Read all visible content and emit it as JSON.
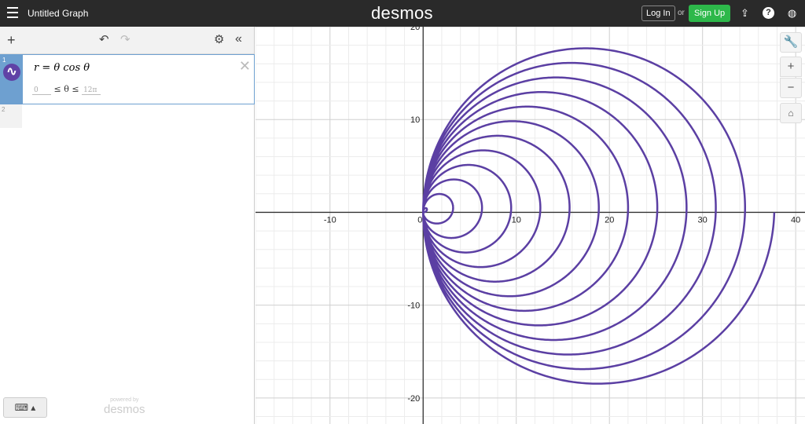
{
  "header": {
    "title": "Untitled Graph",
    "logo": "desmos",
    "login": "Log In",
    "or": "or",
    "signup": "Sign Up"
  },
  "expressions": [
    {
      "index": "1",
      "latex": "r = θ cos θ",
      "domain_min": "0",
      "domain_op1": "≤ θ ≤",
      "domain_max": "12π"
    },
    {
      "index": "2"
    }
  ],
  "footer": {
    "powered": "powered by",
    "logo": "desmos"
  },
  "colors": {
    "curve": "#5b3fa3",
    "signup": "#2db84a"
  },
  "chart_data": {
    "type": "line",
    "equation": "r = θ cos θ",
    "theta_range": [
      0,
      37.699
    ],
    "xlim": [
      -18,
      41
    ],
    "ylim": [
      -22.8,
      20
    ],
    "x_ticks": [
      "-10",
      "0",
      "10",
      "20",
      "30",
      "40"
    ],
    "y_ticks": [
      "20",
      "10",
      "-10",
      "-20"
    ],
    "grid": true
  }
}
